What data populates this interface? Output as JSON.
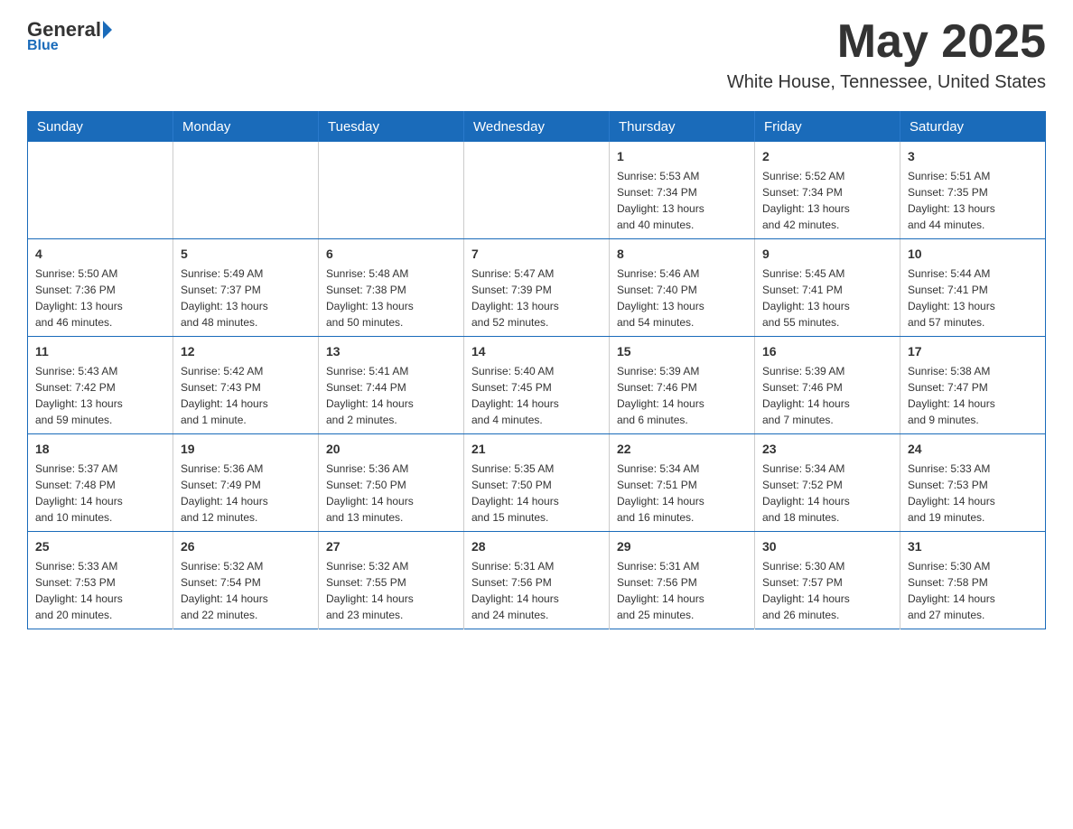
{
  "logo": {
    "general": "General",
    "blue": "Blue",
    "subtitle": "Blue"
  },
  "header": {
    "month": "May 2025",
    "location": "White House, Tennessee, United States"
  },
  "weekdays": [
    "Sunday",
    "Monday",
    "Tuesday",
    "Wednesday",
    "Thursday",
    "Friday",
    "Saturday"
  ],
  "weeks": [
    [
      {
        "day": "",
        "info": ""
      },
      {
        "day": "",
        "info": ""
      },
      {
        "day": "",
        "info": ""
      },
      {
        "day": "",
        "info": ""
      },
      {
        "day": "1",
        "info": "Sunrise: 5:53 AM\nSunset: 7:34 PM\nDaylight: 13 hours\nand 40 minutes."
      },
      {
        "day": "2",
        "info": "Sunrise: 5:52 AM\nSunset: 7:34 PM\nDaylight: 13 hours\nand 42 minutes."
      },
      {
        "day": "3",
        "info": "Sunrise: 5:51 AM\nSunset: 7:35 PM\nDaylight: 13 hours\nand 44 minutes."
      }
    ],
    [
      {
        "day": "4",
        "info": "Sunrise: 5:50 AM\nSunset: 7:36 PM\nDaylight: 13 hours\nand 46 minutes."
      },
      {
        "day": "5",
        "info": "Sunrise: 5:49 AM\nSunset: 7:37 PM\nDaylight: 13 hours\nand 48 minutes."
      },
      {
        "day": "6",
        "info": "Sunrise: 5:48 AM\nSunset: 7:38 PM\nDaylight: 13 hours\nand 50 minutes."
      },
      {
        "day": "7",
        "info": "Sunrise: 5:47 AM\nSunset: 7:39 PM\nDaylight: 13 hours\nand 52 minutes."
      },
      {
        "day": "8",
        "info": "Sunrise: 5:46 AM\nSunset: 7:40 PM\nDaylight: 13 hours\nand 54 minutes."
      },
      {
        "day": "9",
        "info": "Sunrise: 5:45 AM\nSunset: 7:41 PM\nDaylight: 13 hours\nand 55 minutes."
      },
      {
        "day": "10",
        "info": "Sunrise: 5:44 AM\nSunset: 7:41 PM\nDaylight: 13 hours\nand 57 minutes."
      }
    ],
    [
      {
        "day": "11",
        "info": "Sunrise: 5:43 AM\nSunset: 7:42 PM\nDaylight: 13 hours\nand 59 minutes."
      },
      {
        "day": "12",
        "info": "Sunrise: 5:42 AM\nSunset: 7:43 PM\nDaylight: 14 hours\nand 1 minute."
      },
      {
        "day": "13",
        "info": "Sunrise: 5:41 AM\nSunset: 7:44 PM\nDaylight: 14 hours\nand 2 minutes."
      },
      {
        "day": "14",
        "info": "Sunrise: 5:40 AM\nSunset: 7:45 PM\nDaylight: 14 hours\nand 4 minutes."
      },
      {
        "day": "15",
        "info": "Sunrise: 5:39 AM\nSunset: 7:46 PM\nDaylight: 14 hours\nand 6 minutes."
      },
      {
        "day": "16",
        "info": "Sunrise: 5:39 AM\nSunset: 7:46 PM\nDaylight: 14 hours\nand 7 minutes."
      },
      {
        "day": "17",
        "info": "Sunrise: 5:38 AM\nSunset: 7:47 PM\nDaylight: 14 hours\nand 9 minutes."
      }
    ],
    [
      {
        "day": "18",
        "info": "Sunrise: 5:37 AM\nSunset: 7:48 PM\nDaylight: 14 hours\nand 10 minutes."
      },
      {
        "day": "19",
        "info": "Sunrise: 5:36 AM\nSunset: 7:49 PM\nDaylight: 14 hours\nand 12 minutes."
      },
      {
        "day": "20",
        "info": "Sunrise: 5:36 AM\nSunset: 7:50 PM\nDaylight: 14 hours\nand 13 minutes."
      },
      {
        "day": "21",
        "info": "Sunrise: 5:35 AM\nSunset: 7:50 PM\nDaylight: 14 hours\nand 15 minutes."
      },
      {
        "day": "22",
        "info": "Sunrise: 5:34 AM\nSunset: 7:51 PM\nDaylight: 14 hours\nand 16 minutes."
      },
      {
        "day": "23",
        "info": "Sunrise: 5:34 AM\nSunset: 7:52 PM\nDaylight: 14 hours\nand 18 minutes."
      },
      {
        "day": "24",
        "info": "Sunrise: 5:33 AM\nSunset: 7:53 PM\nDaylight: 14 hours\nand 19 minutes."
      }
    ],
    [
      {
        "day": "25",
        "info": "Sunrise: 5:33 AM\nSunset: 7:53 PM\nDaylight: 14 hours\nand 20 minutes."
      },
      {
        "day": "26",
        "info": "Sunrise: 5:32 AM\nSunset: 7:54 PM\nDaylight: 14 hours\nand 22 minutes."
      },
      {
        "day": "27",
        "info": "Sunrise: 5:32 AM\nSunset: 7:55 PM\nDaylight: 14 hours\nand 23 minutes."
      },
      {
        "day": "28",
        "info": "Sunrise: 5:31 AM\nSunset: 7:56 PM\nDaylight: 14 hours\nand 24 minutes."
      },
      {
        "day": "29",
        "info": "Sunrise: 5:31 AM\nSunset: 7:56 PM\nDaylight: 14 hours\nand 25 minutes."
      },
      {
        "day": "30",
        "info": "Sunrise: 5:30 AM\nSunset: 7:57 PM\nDaylight: 14 hours\nand 26 minutes."
      },
      {
        "day": "31",
        "info": "Sunrise: 5:30 AM\nSunset: 7:58 PM\nDaylight: 14 hours\nand 27 minutes."
      }
    ]
  ]
}
